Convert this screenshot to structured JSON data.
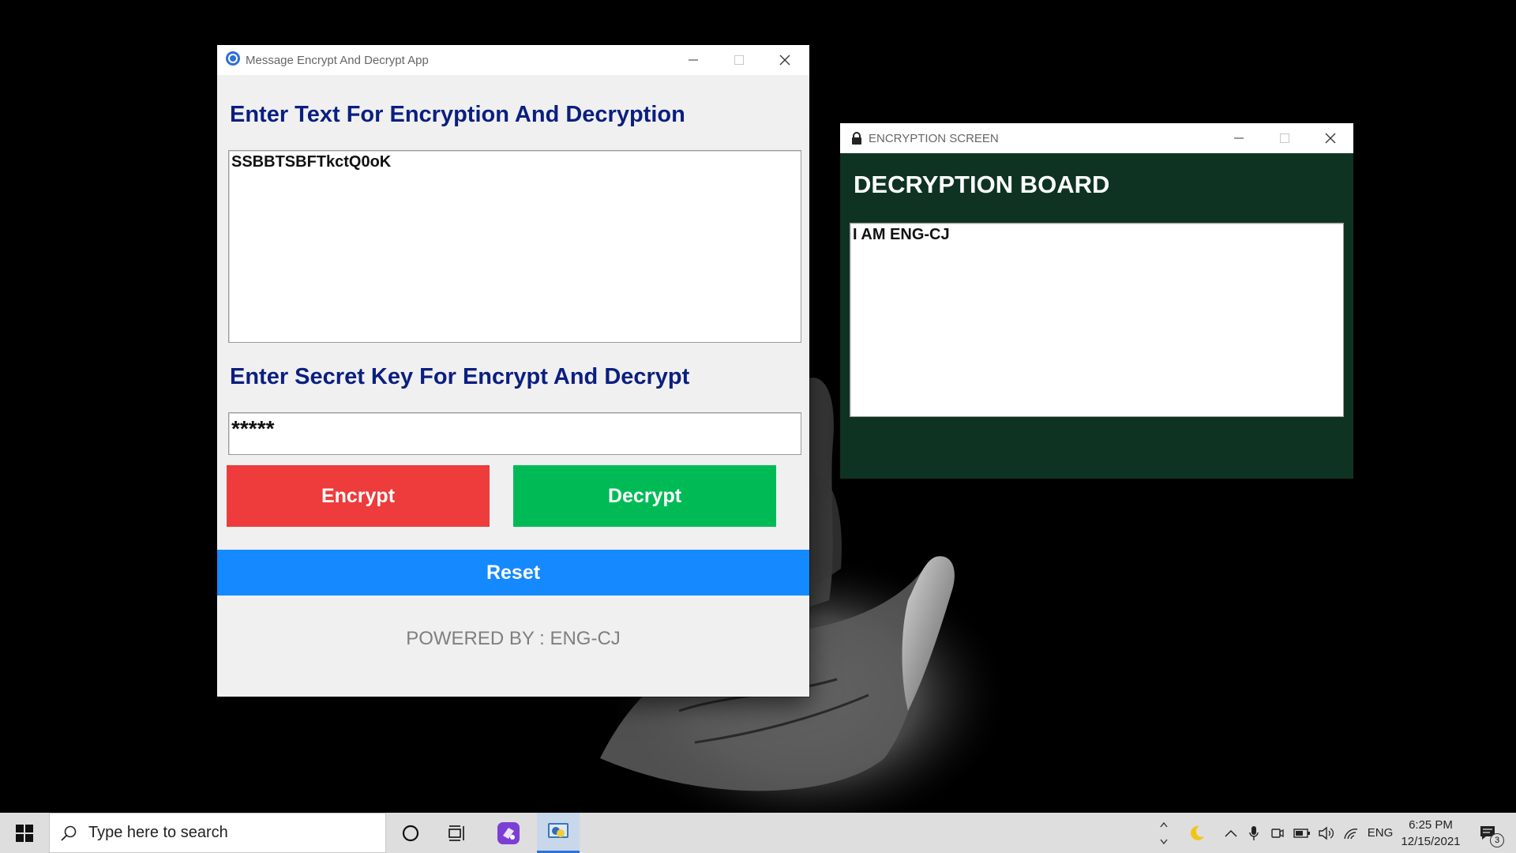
{
  "main_window": {
    "title": "Message Encrypt And Decrypt App",
    "text_heading": "Enter Text For Encryption And Decryption",
    "text_value": "SSBBTSBFTkctQ0oK",
    "key_heading": "Enter Secret Key For Encrypt And Decrypt",
    "key_value": "*****",
    "encrypt_label": "Encrypt",
    "decrypt_label": "Decrypt",
    "reset_label": "Reset",
    "powered_by": "POWERED BY : ENG-CJ",
    "colors": {
      "heading": "#0b1f80",
      "encrypt": "#ee3b3b",
      "decrypt": "#00bb55",
      "reset": "#1589ff",
      "background": "#f0f0f0"
    }
  },
  "decrypt_window": {
    "title": "ENCRYPTION SCREEN",
    "heading": "DECRYPTION BOARD",
    "output_text": "I AM ENG-CJ",
    "colors": {
      "background": "#0e3322"
    }
  },
  "taskbar": {
    "search_placeholder": "Type here to search",
    "language": "ENG",
    "time": "6:25 PM",
    "date": "12/15/2021",
    "notification_count": "3"
  }
}
